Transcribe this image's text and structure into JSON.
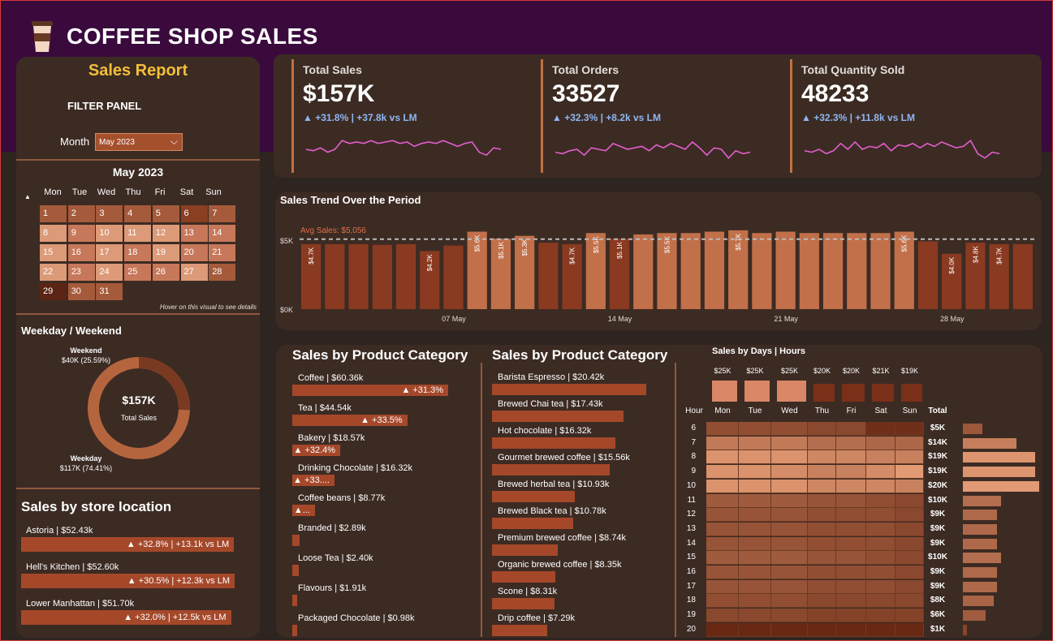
{
  "header": {
    "title": "COFFEE SHOP SALES",
    "logo_icon": "coffee-cup-icon"
  },
  "colors": {
    "header_bg": "#3a0a3d",
    "panel_bg": "#3c2b23",
    "accent": "#a5482a",
    "title_gold": "#f2bf3a",
    "kpi_delta": "#8fb6f2",
    "spark": "#e35ecf"
  },
  "filter": {
    "report_title": "Sales Report",
    "panel_title": "FILTER PANEL",
    "month_label": "Month",
    "month_value": "May 2023"
  },
  "calendar": {
    "title": "May 2023",
    "weekdays": [
      "Mon",
      "Tue",
      "Wed",
      "Thu",
      "Fri",
      "Sat",
      "Sun"
    ],
    "days": [
      "1",
      "2",
      "3",
      "4",
      "5",
      "6",
      "7",
      "8",
      "9",
      "10",
      "11",
      "12",
      "13",
      "14",
      "15",
      "16",
      "17",
      "18",
      "19",
      "20",
      "21",
      "22",
      "23",
      "24",
      "25",
      "26",
      "27",
      "28",
      "29",
      "30",
      "31"
    ],
    "shades": [
      2,
      2,
      2,
      2,
      2,
      1,
      2,
      4,
      3,
      4,
      4,
      4,
      3,
      3,
      4,
      3,
      4,
      3,
      4,
      3,
      3,
      4,
      3,
      4,
      3,
      3,
      4,
      2,
      0,
      2,
      2
    ],
    "hover_note": "Hover on this visual to see details"
  },
  "weekday_weekend": {
    "title": "Weekday / Weekend",
    "center_value": "$157K",
    "center_label": "Total Sales",
    "weekend_label": "Weekend",
    "weekend_value": "$40K (25.59%)",
    "weekday_label": "Weekday",
    "weekday_value": "$117K (74.41%)",
    "weekend_share": 0.2559
  },
  "locations": {
    "title": "Sales by store location",
    "items": [
      {
        "label": "Astoria | $52.43k",
        "delta": "▲ +32.8% | +13.1k vs LM",
        "value": 52.43
      },
      {
        "label": "Hell's Kitchen | $52.60k",
        "delta": "▲ +30.5% | +12.3k vs LM",
        "value": 52.6
      },
      {
        "label": "Lower Manhattan | $51.70k",
        "delta": "▲ +32.0% | +12.5k vs LM",
        "value": 51.7
      }
    ]
  },
  "kpis": [
    {
      "label": "Total Sales",
      "value": "$157K",
      "delta": "▲ +31.8% | +37.8k vs LM",
      "spark": [
        0.5,
        0.45,
        0.55,
        0.4,
        0.5,
        0.8,
        0.7,
        0.75,
        0.7,
        0.8,
        0.7,
        0.75,
        0.8,
        0.7,
        0.75,
        0.6,
        0.7,
        0.75,
        0.7,
        0.8,
        0.7,
        0.6,
        0.7,
        0.75,
        0.4,
        0.3,
        0.55,
        0.5
      ]
    },
    {
      "label": "Total Orders",
      "value": "33527",
      "delta": "▲ +32.3% | +8.2k vs LM",
      "spark": [
        0.4,
        0.35,
        0.45,
        0.5,
        0.3,
        0.55,
        0.5,
        0.45,
        0.7,
        0.6,
        0.5,
        0.55,
        0.6,
        0.45,
        0.65,
        0.55,
        0.7,
        0.6,
        0.5,
        0.75,
        0.55,
        0.3,
        0.55,
        0.5,
        0.2,
        0.45,
        0.35,
        0.4
      ]
    },
    {
      "label": "Total Quantity Sold",
      "value": "48233",
      "delta": "▲ +32.3% | +11.8k vs LM",
      "spark": [
        0.45,
        0.4,
        0.5,
        0.35,
        0.45,
        0.7,
        0.5,
        0.75,
        0.5,
        0.6,
        0.55,
        0.7,
        0.45,
        0.65,
        0.6,
        0.7,
        0.55,
        0.7,
        0.6,
        0.75,
        0.65,
        0.55,
        0.6,
        0.8,
        0.35,
        0.2,
        0.4,
        0.35
      ]
    }
  ],
  "trend": {
    "title": "Sales Trend Over the Period",
    "avg_label": "Avg Sales: $5,056",
    "y_ticks": [
      "$5K",
      "$0K"
    ],
    "x_ticks": [
      "07 May",
      "14 May",
      "21 May",
      "28 May"
    ]
  },
  "chart_data": {
    "type": "bar",
    "title": "Sales Trend Over the Period",
    "categories": [
      "1",
      "2",
      "3",
      "4",
      "5",
      "6",
      "7",
      "8",
      "9",
      "10",
      "11",
      "12",
      "13",
      "14",
      "15",
      "16",
      "17",
      "18",
      "19",
      "20",
      "21",
      "22",
      "23",
      "24",
      "25",
      "26",
      "27",
      "28",
      "29",
      "30",
      "31"
    ],
    "values": [
      4.7,
      4.7,
      4.7,
      4.65,
      4.7,
      4.2,
      4.6,
      5.6,
      5.1,
      5.3,
      4.8,
      4.7,
      5.5,
      5.1,
      5.4,
      5.5,
      5.5,
      5.6,
      5.7,
      5.5,
      5.6,
      5.5,
      5.5,
      5.5,
      5.5,
      5.6,
      4.9,
      4.0,
      4.8,
      4.7,
      4.7
    ],
    "labels": [
      "$4.7K",
      "",
      "",
      "",
      "",
      "$4.2K",
      "",
      "$5.6K",
      "$5.1K",
      "$5.3K",
      "",
      "$4.7K",
      "$5.5K",
      "$5.1K",
      "",
      "$5.5K",
      "",
      "",
      "$5.7K",
      "",
      "",
      "",
      "",
      "",
      "",
      "$5.6K",
      "",
      "$4.0K",
      "$4.8K",
      "$4.7K",
      ""
    ],
    "above_avg": [
      false,
      false,
      false,
      false,
      false,
      false,
      false,
      true,
      true,
      true,
      false,
      false,
      true,
      false,
      true,
      true,
      true,
      true,
      true,
      true,
      true,
      true,
      true,
      true,
      true,
      true,
      false,
      false,
      false,
      false,
      false
    ],
    "average": 5.056,
    "ylim": [
      0,
      6.1
    ]
  },
  "categories_left": {
    "title": "Sales by Product Category",
    "items": [
      {
        "label": "Coffee | $60.36k",
        "delta": "▲ +31.3%",
        "value": 60.36
      },
      {
        "label": "Tea | $44.54k",
        "delta": "▲ +33.5%",
        "value": 44.54
      },
      {
        "label": "Bakery | $18.57k",
        "delta": "▲ +32.4%",
        "value": 18.57
      },
      {
        "label": "Drinking Chocolate | $16.32k",
        "delta": "▲ +33....",
        "value": 16.32
      },
      {
        "label": "Coffee beans | $8.77k",
        "delta": "▲...",
        "value": 8.77
      },
      {
        "label": "Branded | $2.89k",
        "delta": "",
        "value": 2.89
      },
      {
        "label": "Loose Tea | $2.40k",
        "delta": "",
        "value": 2.4
      },
      {
        "label": "Flavours | $1.91k",
        "delta": "",
        "value": 1.91
      },
      {
        "label": "Packaged Chocolate | $0.98k",
        "delta": "",
        "value": 0.98
      }
    ]
  },
  "categories_right": {
    "title": "Sales by Product Category",
    "items": [
      {
        "label": "Barista Espresso | $20.42k",
        "value": 20.42
      },
      {
        "label": "Brewed Chai tea | $17.43k",
        "value": 17.43
      },
      {
        "label": "Hot chocolate | $16.32k",
        "value": 16.32
      },
      {
        "label": "Gourmet brewed coffee | $15.56k",
        "value": 15.56
      },
      {
        "label": "Brewed herbal tea | $10.93k",
        "value": 10.93
      },
      {
        "label": "Brewed Black tea | $10.78k",
        "value": 10.78
      },
      {
        "label": "Premium brewed coffee | $8.74k",
        "value": 8.74
      },
      {
        "label": "Organic brewed coffee | $8.35k",
        "value": 8.35
      },
      {
        "label": "Scone | $8.31k",
        "value": 8.31
      },
      {
        "label": "Drip coffee | $7.29k",
        "value": 7.29
      }
    ]
  },
  "heatmap": {
    "title": "Sales by Days | Hours",
    "hour_header": "Hour",
    "total_header": "Total",
    "days": [
      "Mon",
      "Tue",
      "Wed",
      "Thu",
      "Fri",
      "Sat",
      "Sun"
    ],
    "day_totals": [
      "$25K",
      "$25K",
      "$25K",
      "$20K",
      "$20K",
      "$21K",
      "$19K"
    ],
    "day_values": [
      25,
      25,
      25,
      20,
      20,
      21,
      19
    ],
    "hours": [
      "6",
      "7",
      "8",
      "9",
      "10",
      "11",
      "12",
      "13",
      "14",
      "15",
      "16",
      "17",
      "18",
      "19",
      "20"
    ],
    "hour_totals": [
      "$5K",
      "$14K",
      "$19K",
      "$19K",
      "$20K",
      "$10K",
      "$9K",
      "$9K",
      "$9K",
      "$10K",
      "$9K",
      "$9K",
      "$8K",
      "$6K",
      "$1K"
    ],
    "hour_values": [
      5,
      14,
      19,
      19,
      20,
      10,
      9,
      9,
      9,
      10,
      9,
      9,
      8,
      6,
      1
    ],
    "intensity": [
      [
        0.35,
        0.35,
        0.35,
        0.3,
        0.3,
        0.1,
        0.1
      ],
      [
        0.7,
        0.7,
        0.7,
        0.6,
        0.6,
        0.55,
        0.55
      ],
      [
        0.9,
        0.9,
        0.9,
        0.8,
        0.8,
        0.75,
        0.75
      ],
      [
        0.9,
        0.9,
        0.85,
        0.75,
        0.75,
        0.85,
        0.95
      ],
      [
        0.9,
        0.9,
        0.9,
        0.8,
        0.8,
        0.8,
        0.75
      ],
      [
        0.45,
        0.45,
        0.45,
        0.4,
        0.4,
        0.35,
        0.3
      ],
      [
        0.4,
        0.4,
        0.4,
        0.35,
        0.35,
        0.35,
        0.3
      ],
      [
        0.4,
        0.4,
        0.4,
        0.35,
        0.35,
        0.35,
        0.3
      ],
      [
        0.4,
        0.4,
        0.4,
        0.35,
        0.35,
        0.35,
        0.3
      ],
      [
        0.45,
        0.45,
        0.45,
        0.4,
        0.4,
        0.35,
        0.3
      ],
      [
        0.4,
        0.4,
        0.4,
        0.35,
        0.35,
        0.35,
        0.3
      ],
      [
        0.4,
        0.4,
        0.4,
        0.35,
        0.35,
        0.35,
        0.3
      ],
      [
        0.35,
        0.35,
        0.35,
        0.3,
        0.3,
        0.3,
        0.3
      ],
      [
        0.3,
        0.3,
        0.3,
        0.25,
        0.25,
        0.25,
        0.25
      ],
      [
        0.05,
        0.05,
        0.05,
        0.05,
        0.05,
        0.05,
        0.05
      ]
    ]
  }
}
